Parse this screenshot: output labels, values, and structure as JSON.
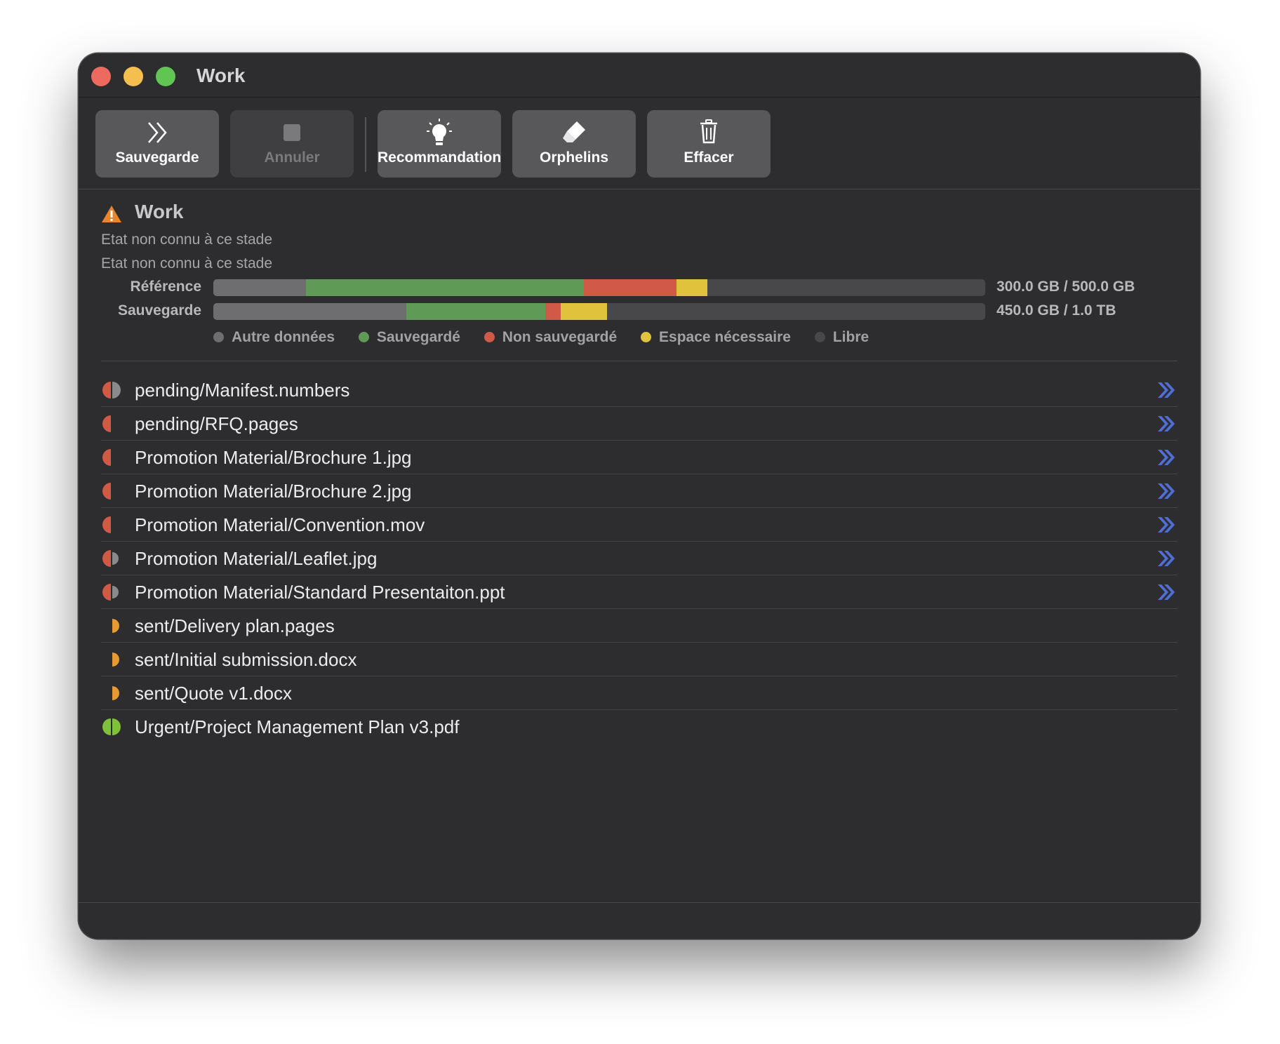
{
  "window": {
    "title": "Work"
  },
  "toolbar": {
    "buttons": [
      {
        "label": "Sauvegarde",
        "icon": "chevron-double-right-icon",
        "enabled": true
      },
      {
        "label": "Annuler",
        "icon": "stop-square-icon",
        "enabled": false
      },
      {
        "label": "Recommandation",
        "icon": "lightbulb-icon",
        "enabled": true
      },
      {
        "label": "Orphelins",
        "icon": "eraser-icon",
        "enabled": true
      },
      {
        "label": "Effacer",
        "icon": "trash-icon",
        "enabled": true
      }
    ]
  },
  "header": {
    "title": "Work",
    "status_icon": "warning-triangle-icon",
    "state_lines": [
      "Etat non connu à ce stade",
      "Etat non connu à ce stade"
    ],
    "bars": [
      {
        "label": "Référence",
        "value_text": "300.0 GB / 500.0 GB",
        "segments_pct": {
          "autre": 12,
          "sauvegarde": 36,
          "non_sauvegarde": 12,
          "espace": 4
        }
      },
      {
        "label": "Sauvegarde",
        "value_text": "450.0 GB / 1.0 TB",
        "segments_pct": {
          "autre": 25,
          "sauvegarde": 18,
          "non_sauvegarde": 2,
          "espace": 6
        }
      }
    ],
    "legend": [
      {
        "label": "Autre données",
        "color": "#6e6e70"
      },
      {
        "label": "Sauvegardé",
        "color": "#5f9a57"
      },
      {
        "label": "Non sauvegardé",
        "color": "#d05a47"
      },
      {
        "label": "Espace nécessaire",
        "color": "#e0c23c"
      },
      {
        "label": "Libre",
        "color": "#48484a"
      }
    ]
  },
  "files": [
    {
      "path": "pending/Manifest.numbers",
      "status": "red-gray",
      "has_action": true
    },
    {
      "path": "pending/RFQ.pages",
      "status": "red-half",
      "has_action": true
    },
    {
      "path": "Promotion Material/Brochure 1.jpg",
      "status": "red-half",
      "has_action": true
    },
    {
      "path": "Promotion Material/Brochure 2.jpg",
      "status": "red-half",
      "has_action": true
    },
    {
      "path": "Promotion Material/Convention.mov",
      "status": "red-half",
      "has_action": true
    },
    {
      "path": "Promotion Material/Leaflet.jpg",
      "status": "red-gray-small",
      "has_action": true
    },
    {
      "path": "Promotion Material/Standard Presentaiton.ppt",
      "status": "red-gray-small",
      "has_action": true
    },
    {
      "path": "sent/Delivery plan.pages",
      "status": "orange-half",
      "has_action": false
    },
    {
      "path": "sent/Initial submission.docx",
      "status": "orange-half",
      "has_action": false
    },
    {
      "path": "sent/Quote v1.docx",
      "status": "orange-half",
      "has_action": false
    },
    {
      "path": "Urgent/Project Management Plan v3.pdf",
      "status": "green-full",
      "has_action": false
    }
  ],
  "colors": {
    "accent_blue": "#4f6fd6",
    "red": "#d05a47",
    "orange": "#e79a32",
    "green": "#7fc23a",
    "gray": "#8a8a8c"
  }
}
